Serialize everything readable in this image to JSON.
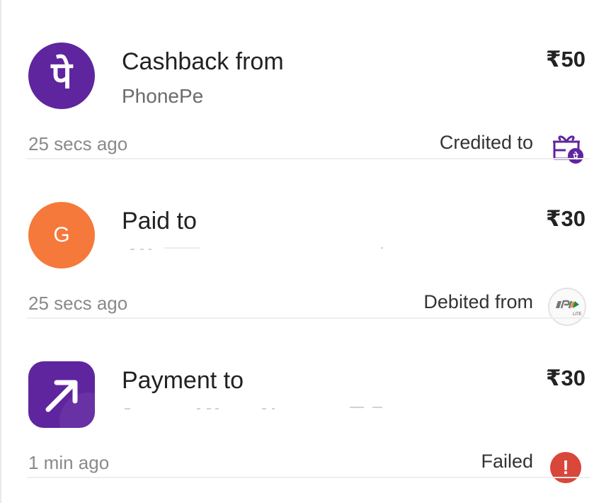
{
  "transactions": [
    {
      "title": "Cashback from",
      "subtitle": "PhonePe",
      "amount": "₹50",
      "time": "25 secs ago",
      "status_label": "Credited to",
      "avatar_icon": "phonepe-logo-icon",
      "avatar_glyph": "पे",
      "status_icon": "phonepe-gift-wallet-icon"
    },
    {
      "title": "Paid to",
      "amount": "₹30",
      "time": "25 secs ago",
      "status_label": "Debited from",
      "avatar_initial": "G",
      "avatar_icon": "contact-avatar",
      "status_icon": "upi-lite-icon",
      "upi_lite_text": "LITE"
    },
    {
      "title": "Payment to",
      "amount": "₹30",
      "time": "1 min ago",
      "status_label": "Failed",
      "avatar_icon": "arrow-up-right-icon",
      "status_icon": "error-icon",
      "status_glyph": "!"
    }
  ],
  "colors": {
    "brand_purple": "#5f259f",
    "avatar_orange": "#f5793b",
    "failed_red": "#d9463a",
    "secondary_text": "#8a8a8a"
  }
}
